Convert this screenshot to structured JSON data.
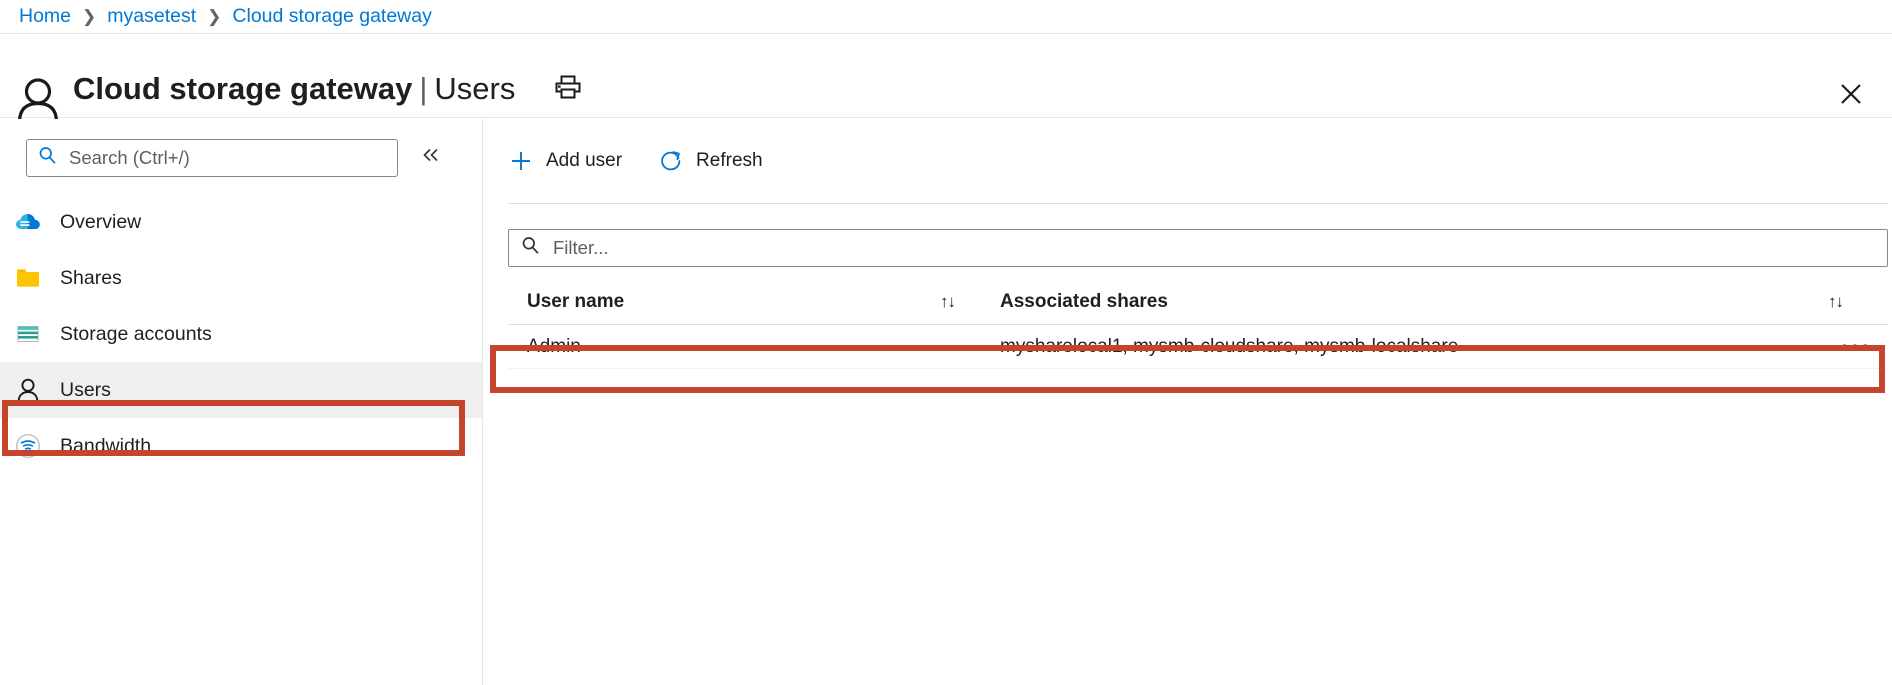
{
  "breadcrumb": {
    "items": [
      {
        "label": "Home"
      },
      {
        "label": "myasetest"
      },
      {
        "label": "Cloud storage gateway"
      }
    ],
    "separator": "❯"
  },
  "header": {
    "avatar_icon": "person-icon",
    "title_main": "Cloud storage gateway",
    "title_separator": "|",
    "title_section": "Users",
    "subtitle": "myasetest",
    "print_icon": "printer-icon",
    "close_icon": "close-icon"
  },
  "sidebar": {
    "search": {
      "placeholder": "Search (Ctrl+/)",
      "value": "",
      "icon": "search-icon"
    },
    "collapse_icon": "chevron-double-left-icon",
    "items": [
      {
        "label": "Overview",
        "icon": "cloud-icon",
        "selected": false
      },
      {
        "label": "Shares",
        "icon": "folder-icon",
        "selected": false
      },
      {
        "label": "Storage accounts",
        "icon": "storage-accounts-icon",
        "selected": false
      },
      {
        "label": "Users",
        "icon": "person-icon",
        "selected": true
      },
      {
        "label": "Bandwidth",
        "icon": "bandwidth-icon",
        "selected": false
      }
    ]
  },
  "toolbar": {
    "add_user_label": "Add user",
    "add_user_icon": "plus-icon",
    "refresh_label": "Refresh",
    "refresh_icon": "refresh-icon"
  },
  "filter": {
    "placeholder": "Filter...",
    "value": "",
    "icon": "search-icon"
  },
  "table": {
    "columns": [
      {
        "header": "User name",
        "sortable": true
      },
      {
        "header": "Associated shares",
        "sortable": true
      }
    ],
    "sort_glyph": "↑↓",
    "rows": [
      {
        "user_name": "Admin",
        "associated_shares": "mysharelocal1, mysmb-cloudshare, mysmb-localshare",
        "menu_glyph": "•••"
      }
    ]
  },
  "colors": {
    "accent": "#0078d4",
    "annotation": "#c4452c",
    "selected_row_bg": "#efefef",
    "folder_yellow": "#ffc400",
    "storage_teal": "#2e9e8f"
  }
}
